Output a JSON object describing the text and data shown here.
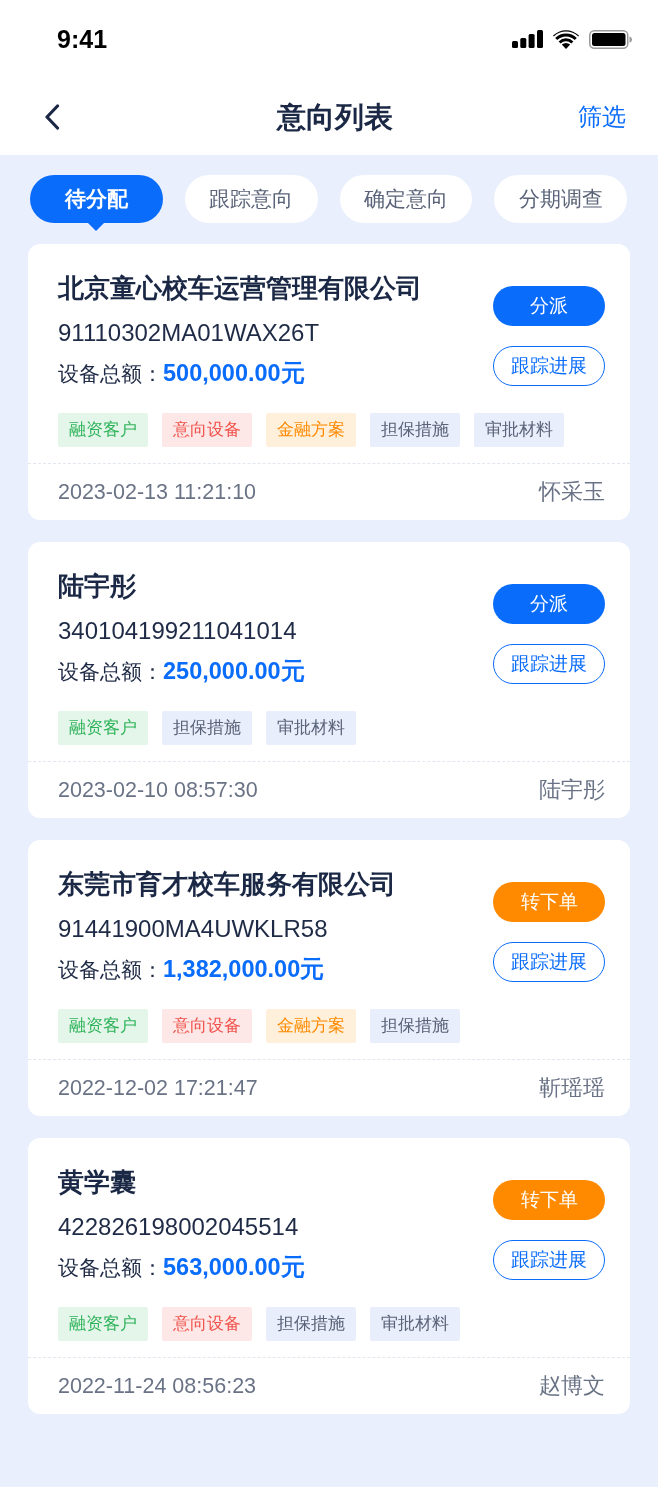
{
  "status_bar": {
    "time": "9:41"
  },
  "nav_bar": {
    "title": "意向列表",
    "action": "筛选"
  },
  "tabs": [
    {
      "label": "待分配",
      "selected": true
    },
    {
      "label": "跟踪意向",
      "selected": false
    },
    {
      "label": "确定意向",
      "selected": false
    },
    {
      "label": "分期调查",
      "selected": false
    }
  ],
  "cards": [
    {
      "name": "北京童心校车运营管理有限公司",
      "id_number": "91110302MA01WAX26T",
      "amount_label": "设备总额：",
      "amount": "500,000.00元",
      "tags": [
        {
          "label": "融资客户",
          "kind": "client"
        },
        {
          "label": "意向设备",
          "kind": "equipment"
        },
        {
          "label": "金融方案",
          "kind": "plan"
        },
        {
          "label": "担保措施",
          "kind": "guarantee"
        },
        {
          "label": "审批材料",
          "kind": "approval"
        }
      ],
      "date": "2023-02-13 11:21:10",
      "person": "怀采玉",
      "primary_action": {
        "label": "分派",
        "kind": "assign"
      },
      "secondary_action": "跟踪进展"
    },
    {
      "name": "陆宇彤",
      "id_number": "340104199211041014",
      "amount_label": "设备总额：",
      "amount": "250,000.00元",
      "tags": [
        {
          "label": "融资客户",
          "kind": "client"
        },
        {
          "label": "担保措施",
          "kind": "guarantee"
        },
        {
          "label": "审批材料",
          "kind": "approval"
        }
      ],
      "date": "2023-02-10 08:57:30",
      "person": "陆宇彤",
      "primary_action": {
        "label": "分派",
        "kind": "assign"
      },
      "secondary_action": "跟踪进展"
    },
    {
      "name": "东莞市育才校车服务有限公司",
      "id_number": "91441900MA4UWKLR58",
      "amount_label": "设备总额：",
      "amount": "1,382,000.00元",
      "tags": [
        {
          "label": "融资客户",
          "kind": "client"
        },
        {
          "label": "意向设备",
          "kind": "equipment"
        },
        {
          "label": "金融方案",
          "kind": "plan"
        },
        {
          "label": "担保措施",
          "kind": "guarantee"
        }
      ],
      "date": "2022-12-02 17:21:47",
      "person": "靳瑶瑶",
      "primary_action": {
        "label": "转下单",
        "kind": "order"
      },
      "secondary_action": "跟踪进展"
    },
    {
      "name": "黄学囊",
      "id_number": "422826198002045514",
      "amount_label": "设备总额：",
      "amount": "563,000.00元",
      "tags": [
        {
          "label": "融资客户",
          "kind": "client"
        },
        {
          "label": "意向设备",
          "kind": "equipment"
        },
        {
          "label": "担保措施",
          "kind": "guarantee"
        },
        {
          "label": "审批材料",
          "kind": "approval"
        }
      ],
      "date": "2022-11-24 08:56:23",
      "person": "赵博文",
      "primary_action": {
        "label": "转下单",
        "kind": "order"
      },
      "secondary_action": "跟踪进展"
    }
  ]
}
